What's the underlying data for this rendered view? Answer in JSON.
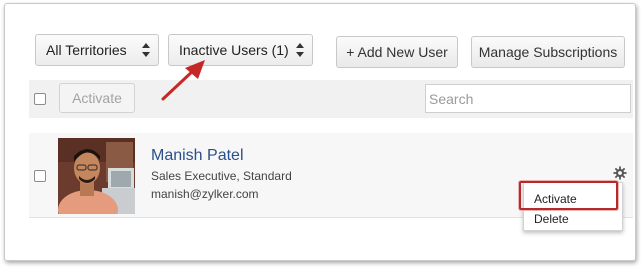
{
  "filters": {
    "territory_select": "All Territories",
    "status_select": "Inactive Users (1)"
  },
  "toolbar": {
    "add_user_label": "+ Add New User",
    "manage_subscriptions_label": "Manage Subscriptions",
    "activate_label": "Activate"
  },
  "search": {
    "placeholder": "Search"
  },
  "user": {
    "name": "Manish Patel",
    "role": "Sales Executive, Standard",
    "email": "manish@zylker.com"
  },
  "context_menu": {
    "items": [
      "Activate",
      "Delete"
    ]
  },
  "icons": {
    "settings": "gear-icon",
    "select_arrows": "updown-arrows-icon",
    "annotation": "red-arrow-icon"
  },
  "colors": {
    "link": "#2a4f8a",
    "highlight": "#b52a2a",
    "annotation_arrow": "#c62828"
  }
}
